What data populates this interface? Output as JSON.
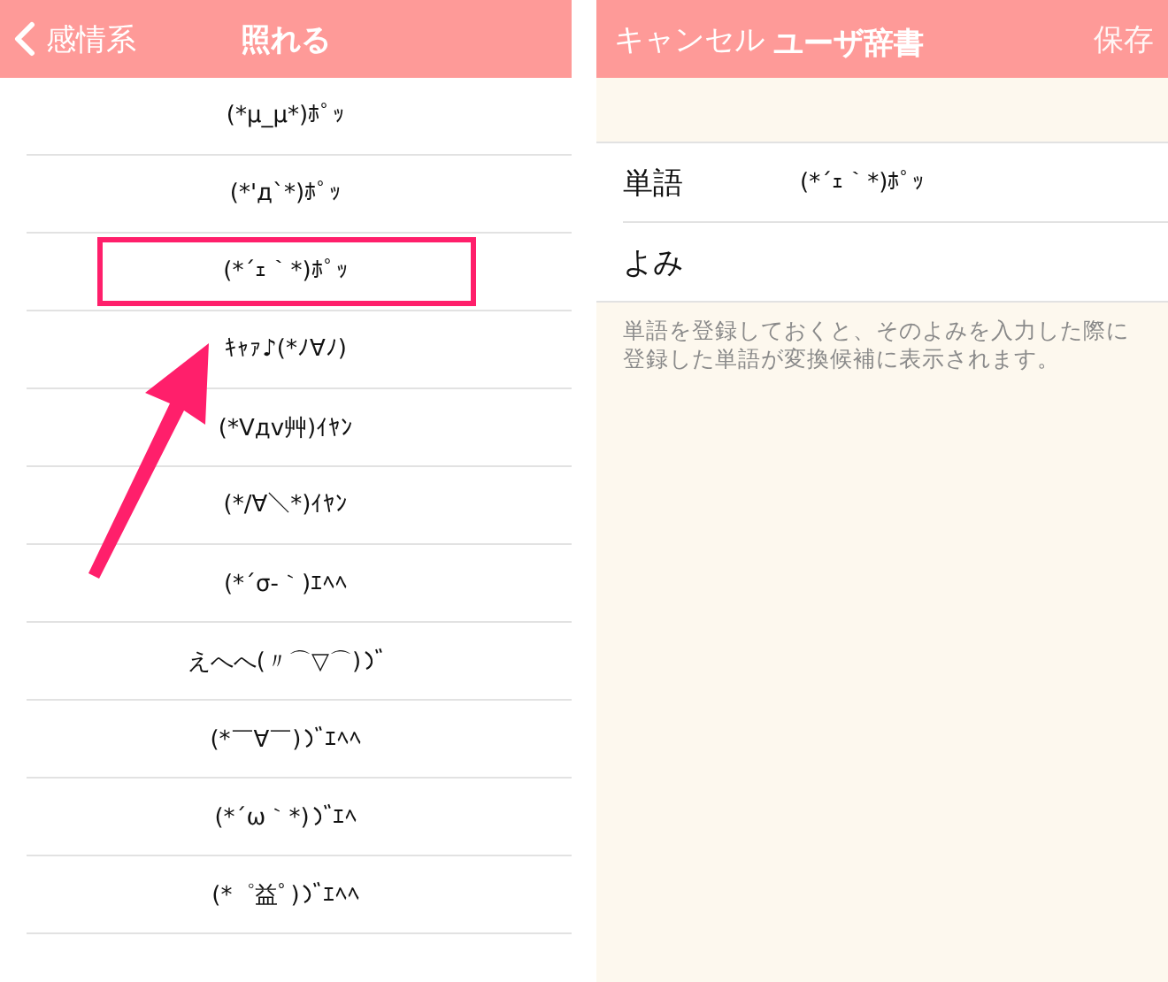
{
  "left_panel": {
    "back_label": "感情系",
    "title": "照れる",
    "rows": [
      {
        "text": "(*μ_μ*)ﾎﾟｯ",
        "selected": false
      },
      {
        "text": "(*'д`*)ﾎﾟｯ",
        "selected": false
      },
      {
        "text": "(*´ｪ｀*)ﾎﾟｯ",
        "selected": true
      },
      {
        "text": "ｷｬｧ♪(*ﾉ∀ﾉ)",
        "selected": false
      },
      {
        "text": "(*Vдv艸)ｲﾔﾝ",
        "selected": false
      },
      {
        "text": "(*/∀＼*)ｲﾔﾝ",
        "selected": false
      },
      {
        "text": "(*´σ-｀)ｴﾍﾍ",
        "selected": false
      },
      {
        "kind": "marked",
        "text": "えへへ(〃⌒▽⌒)",
        "selected": false
      },
      {
        "kind": "marked",
        "text": "(*￣∀￣)",
        "tail": "ｴﾍﾍ",
        "selected": false
      },
      {
        "kind": "marked",
        "text": "(*´ω｀*)",
        "tail": "ｴﾍ",
        "selected": false
      },
      {
        "kind": "marked",
        "text": "(*゜益ﾟ)",
        "tail": "ｴﾍﾍ",
        "selected": false
      }
    ]
  },
  "right_panel": {
    "cancel": "キャンセル",
    "title": "ユーザ辞書",
    "save": "保存",
    "save_disabled": true,
    "fields": [
      {
        "label": "単語",
        "value": "(*´ｪ｀*)ﾎﾟｯ"
      },
      {
        "label": "よみ"
      }
    ],
    "help": "単語を登録しておくと、そのよみを入力した際に登録した単語が変換候補に表示されます。"
  }
}
